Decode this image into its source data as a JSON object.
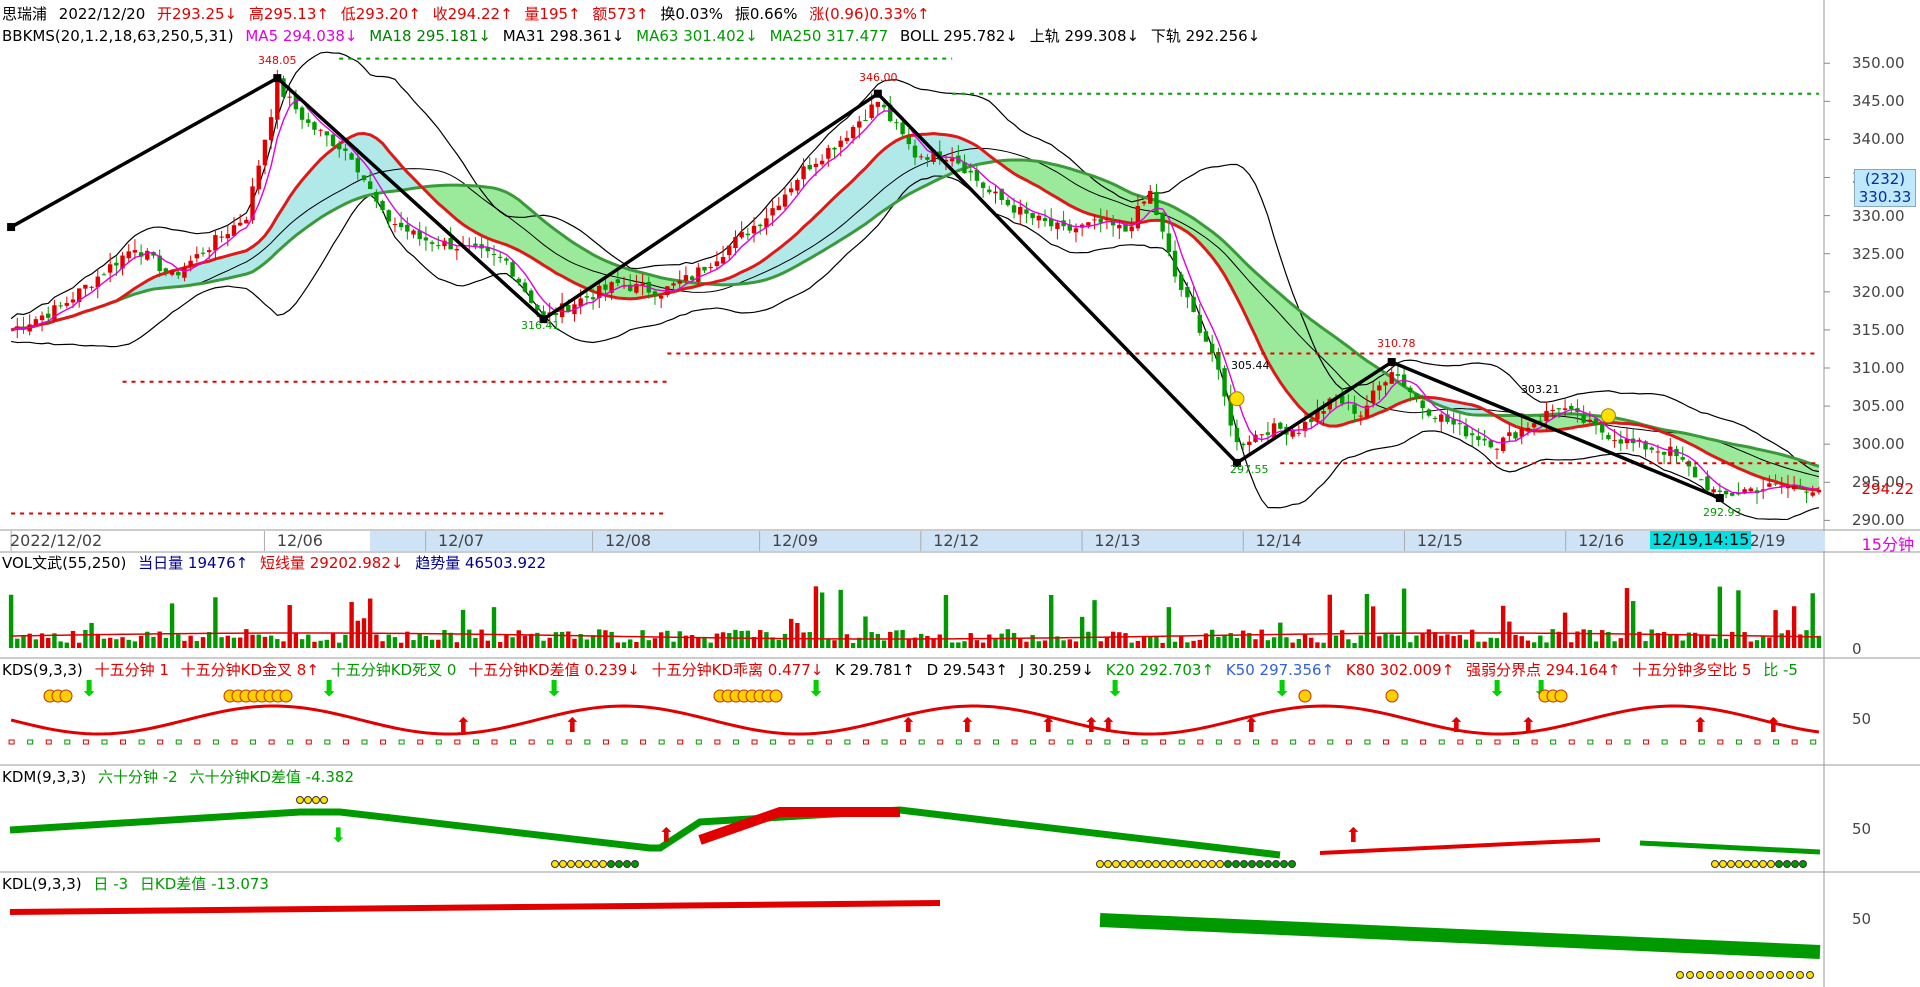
{
  "header": {
    "name": "思瑞浦",
    "date": "2022/12/20",
    "open": "开293.25↓",
    "high": "高295.13↑",
    "low": "低293.20↑",
    "close": "收294.22↑",
    "volume": "量195↑",
    "amount": "额573↑",
    "turnover": "换0.03%",
    "amplitude": "振0.66%",
    "change": "涨(0.96)0.33%↑"
  },
  "main_indicator": {
    "name": "BBKMS(20,1.2,18,63,250,5,31)",
    "ma5": "MA5 294.038↓",
    "ma18": "MA18 295.181↓",
    "ma31": "MA31 298.361↓",
    "ma63": "MA63 301.402↓",
    "ma250": "MA250 317.477",
    "boll": "BOLL 295.782↓",
    "upper": "上轨 299.308↓",
    "lower": "下轨 292.256↓"
  },
  "price_axis": {
    "ticks": [
      "350.00",
      "345.00",
      "340.00",
      "335.00",
      "330.00",
      "325.00",
      "320.00",
      "315.00",
      "310.00",
      "305.00",
      "300.00",
      "295.00",
      "290.00"
    ],
    "cursor_count": "(232)",
    "cursor_price": "330.33",
    "last_price": "294.22"
  },
  "annotations": {
    "peak1": "348.05",
    "trough1": "316.41",
    "peak2": "346.00",
    "trough2": "297.55",
    "mid1": "305.44",
    "peak3": "310.78",
    "mid2": "303.21",
    "trough3": "292.93"
  },
  "time_axis": {
    "labels": [
      "2022/12/02",
      "12/06",
      "12/07",
      "12/08",
      "12/09",
      "12/12",
      "12/13",
      "12/14",
      "12/15",
      "12/16",
      "12/19"
    ],
    "cursor_time": "12/19,14:15",
    "timeframe": "15分钟"
  },
  "vol_panel": {
    "name": "VOL文武(55,250)",
    "today": "当日量 19476↑",
    "short": "短线量 29202.982↓",
    "trend": "趋势量 46503.922",
    "axis_zero": "0"
  },
  "kds_panel": {
    "name": "KDS(9,3,3)",
    "items": [
      "十五分钟 1",
      "十五分钟KD金叉 8↑",
      "十五分钟KD死叉 0",
      "十五分钟KD差值 0.239↓",
      "十五分钟KD乖离 0.477↓",
      "K 29.781↑",
      "D 29.543↑",
      "J 30.259↓",
      "K20 292.703↑",
      "K50 297.356↑",
      "K80 302.009↑",
      "强弱分界点 294.164↑",
      "十五分钟多空比 5",
      "比 -5"
    ],
    "axis": "50"
  },
  "kdm_panel": {
    "name": "KDM(9,3,3)",
    "items": [
      "六十分钟 -2",
      "六十分钟KD差值 -4.382"
    ],
    "axis": "50"
  },
  "kdl_panel": {
    "name": "KDL(9,3,3)",
    "items": [
      "日 -3",
      "日KD差值 -13.073"
    ],
    "axis": "50"
  },
  "chart_data": {
    "type": "candlestick",
    "ylim": [
      289,
      352
    ],
    "zigzag": [
      {
        "bar": 0,
        "price": 328.5
      },
      {
        "bar": 43,
        "price": 348.05
      },
      {
        "bar": 86,
        "price": 316.41
      },
      {
        "bar": 140,
        "price": 346.0
      },
      {
        "bar": 198,
        "price": 297.55
      },
      {
        "bar": 223,
        "price": 310.78
      },
      {
        "bar": 276,
        "price": 292.93
      }
    ],
    "dotted_levels": [
      {
        "price": 311.9,
        "from_bar": 106,
        "to_bar": 292,
        "color": "#e00000"
      },
      {
        "price": 346.0,
        "from_bar": 152,
        "to_bar": 292,
        "color": "#00a000"
      },
      {
        "price": 297.5,
        "from_bar": 205,
        "to_bar": 292,
        "color": "#e00000"
      },
      {
        "price": 308.2,
        "from_bar": 18,
        "to_bar": 106,
        "color": "#e00000"
      },
      {
        "price": 290.9,
        "from_bar": 0,
        "to_bar": 106,
        "color": "#e00000"
      },
      {
        "price": 350.6,
        "from_bar": 53,
        "to_bar": 152,
        "color": "#00a000"
      }
    ],
    "keypoints": [
      [
        0,
        315
      ],
      [
        8,
        318
      ],
      [
        14,
        322
      ],
      [
        20,
        326
      ],
      [
        26,
        322
      ],
      [
        32,
        326
      ],
      [
        38,
        330
      ],
      [
        43,
        347
      ],
      [
        48,
        342
      ],
      [
        55,
        338
      ],
      [
        60,
        330
      ],
      [
        66,
        327
      ],
      [
        72,
        326
      ],
      [
        80,
        324
      ],
      [
        86,
        316.5
      ],
      [
        92,
        319
      ],
      [
        98,
        321
      ],
      [
        105,
        320
      ],
      [
        110,
        322
      ],
      [
        116,
        326
      ],
      [
        122,
        330
      ],
      [
        128,
        336
      ],
      [
        134,
        340
      ],
      [
        140,
        345
      ],
      [
        146,
        338
      ],
      [
        152,
        338
      ],
      [
        158,
        333
      ],
      [
        164,
        330
      ],
      [
        170,
        328
      ],
      [
        176,
        329
      ],
      [
        180,
        328
      ],
      [
        184,
        333
      ],
      [
        188,
        322
      ],
      [
        194,
        312
      ],
      [
        198,
        300
      ],
      [
        203,
        302
      ],
      [
        208,
        302
      ],
      [
        214,
        306
      ],
      [
        218,
        304
      ],
      [
        223,
        310
      ],
      [
        228,
        305
      ],
      [
        234,
        302
      ],
      [
        240,
        300
      ],
      [
        246,
        303
      ],
      [
        250,
        305
      ],
      [
        256,
        302
      ],
      [
        262,
        300
      ],
      [
        268,
        299
      ],
      [
        272,
        296
      ],
      [
        276,
        293
      ],
      [
        280,
        294
      ],
      [
        286,
        294.5
      ],
      [
        292,
        294.2
      ]
    ]
  }
}
